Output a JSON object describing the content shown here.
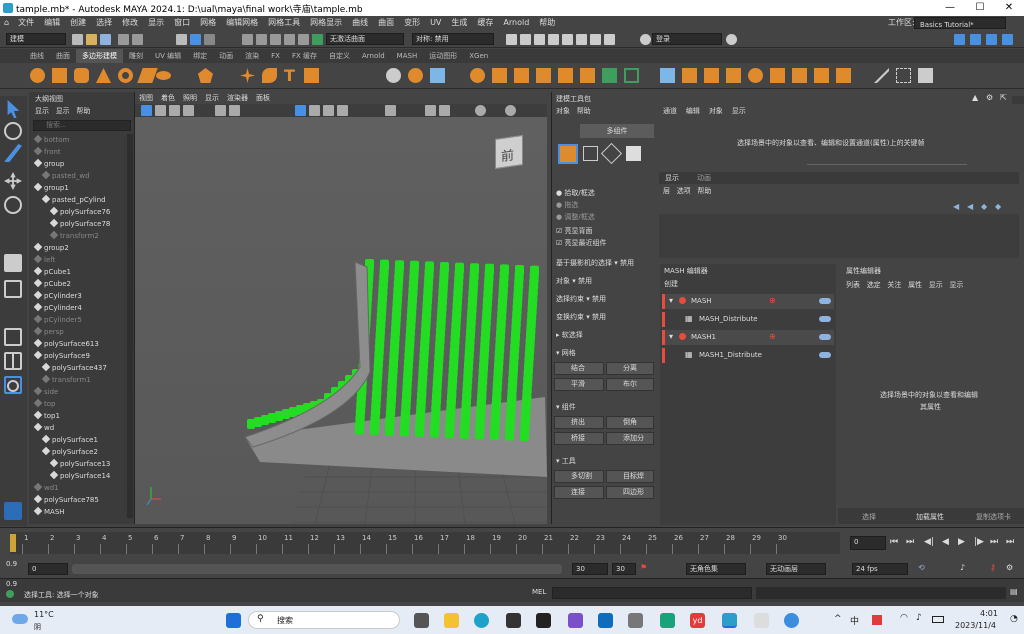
{
  "title": "tample.mb* - Autodesk MAYA 2024.1: D:\\ual\\maya\\final work\\寺庙\\tample.mb",
  "menus": [
    "文件",
    "编辑",
    "创建",
    "选择",
    "修改",
    "显示",
    "窗口",
    "网格",
    "编辑网格",
    "网格工具",
    "网格显示",
    "曲线",
    "曲面",
    "变形",
    "UV",
    "生成",
    "缓存",
    "Arnold",
    "帮助"
  ],
  "workspace_label": "工作区:",
  "workspace": "Basics Tutorial*",
  "mode": "建模",
  "no_live": "无激活曲面",
  "symmetry": "对称: 禁用",
  "login": "登录",
  "shelf_tabs": [
    "曲线",
    "曲面",
    "多边形建模",
    "雕刻",
    "UV 编辑",
    "绑定",
    "动画",
    "渲染",
    "FX",
    "FX 缓存",
    "自定义",
    "Arnold",
    "MASH",
    "运动图形",
    "XGen"
  ],
  "outliner": {
    "title": "大纲视图",
    "menu": [
      "显示",
      "显示",
      "帮助"
    ],
    "search": "搜索...",
    "items": [
      {
        "t": "bottom",
        "d": 0,
        "dim": true
      },
      {
        "t": "front",
        "d": 0,
        "dim": true
      },
      {
        "t": "group",
        "d": 0
      },
      {
        "t": "pasted_wd",
        "d": 1,
        "dim": true
      },
      {
        "t": "group1",
        "d": 0
      },
      {
        "t": "pasted_pCylind",
        "d": 1
      },
      {
        "t": "polySurface76",
        "d": 2
      },
      {
        "t": "polySurface78",
        "d": 2
      },
      {
        "t": "transform2",
        "d": 2,
        "dim": true
      },
      {
        "t": "group2",
        "d": 0
      },
      {
        "t": "left",
        "d": 0,
        "dim": true
      },
      {
        "t": "pCube1",
        "d": 0
      },
      {
        "t": "pCube2",
        "d": 0
      },
      {
        "t": "pCylinder3",
        "d": 0
      },
      {
        "t": "pCylinder4",
        "d": 0
      },
      {
        "t": "pCylinder5",
        "d": 0,
        "dim": true
      },
      {
        "t": "persp",
        "d": 0,
        "dim": true
      },
      {
        "t": "polySurface613",
        "d": 0
      },
      {
        "t": "polySurface9",
        "d": 0
      },
      {
        "t": "polySurface437",
        "d": 1
      },
      {
        "t": "transform1",
        "d": 1,
        "dim": true
      },
      {
        "t": "side",
        "d": 0,
        "dim": true
      },
      {
        "t": "top",
        "d": 0,
        "dim": true
      },
      {
        "t": "top1",
        "d": 0
      },
      {
        "t": "wd",
        "d": 0
      },
      {
        "t": "polySurface1",
        "d": 1
      },
      {
        "t": "polySurface2",
        "d": 1
      },
      {
        "t": "polySurface13",
        "d": 2
      },
      {
        "t": "polySurface14",
        "d": 2
      },
      {
        "t": "wd1",
        "d": 0,
        "dim": true
      },
      {
        "t": "polySurface785",
        "d": 0
      },
      {
        "t": "MASH",
        "d": 0
      }
    ]
  },
  "viewport": {
    "menu": [
      "视图",
      "着色",
      "照明",
      "显示",
      "渲染器",
      "面板"
    ],
    "viewcube": "前"
  },
  "mtk": {
    "title": "建模工具包",
    "menu": [
      "对象",
      "帮助"
    ],
    "mode": "多组件",
    "pick": "拾取/框选",
    "drag": "拖选",
    "tweak": "调整/框选",
    "backface": "亮显背面",
    "nearest": "亮显最近组件",
    "camera_sel": "基于摄影机的选择",
    "off": "禁用",
    "obj": "对象",
    "sel_constraint": "选择约束",
    "xform_constraint": "变换约束",
    "soft": "软选择",
    "mesh": "网格",
    "combine": "结合",
    "separate": "分离",
    "smooth": "平滑",
    "boolean": "布尔",
    "components": "组件",
    "extrude": "挤出",
    "bevel": "倒角",
    "bridge": "桥接",
    "add_div": "添加分",
    "tools": "工具",
    "multicut": "多切割",
    "target_weld": "目标焊",
    "connect": "连接",
    "quad_draw": "四边形"
  },
  "channel": {
    "menu": [
      "通道",
      "编辑",
      "对象",
      "显示"
    ],
    "msg": "选择场景中的对象以查看、编辑和设置通道(属性)上的关键帧",
    "layer_tabs": [
      "显示",
      "动画"
    ],
    "layer_menu": [
      "层",
      "选项",
      "帮助"
    ]
  },
  "mash": {
    "title": "MASH 编辑器",
    "create": "创建",
    "nodes": [
      {
        "name": "MASH",
        "child": "MASH_Distribute"
      },
      {
        "name": "MASH1",
        "child": "MASH1_Distribute"
      }
    ]
  },
  "attr": {
    "title": "属性编辑器",
    "menu": [
      "列表",
      "选定",
      "关注",
      "属性",
      "显示",
      "显示"
    ],
    "msg1": "选择场景中的对象以查看和编辑",
    "msg2": "其属性",
    "footer": [
      "选择",
      "加载属性",
      "复制选项卡"
    ]
  },
  "timeline": {
    "ticks": [
      "1",
      "2",
      "3",
      "4",
      "5",
      "6",
      "7",
      "8",
      "9",
      "10",
      "11",
      "12",
      "13",
      "14",
      "15",
      "16",
      "17",
      "18",
      "19",
      "20",
      "21",
      "22",
      "23",
      "24",
      "25",
      "26",
      "27",
      "28",
      "29",
      "30"
    ],
    "current": "0"
  },
  "range": {
    "start": "0.9",
    "start2": "0",
    "end": "30",
    "end2": "30",
    "char": "无角色集",
    "anim": "无动画层",
    "fps": "24 fps",
    "frame_a": "0.9",
    "frame_b": "0.9"
  },
  "cmd": {
    "lang": "MEL",
    "status": "选择工具: 选择一个对象"
  },
  "taskbar": {
    "temp": "11°C",
    "weather": "阴",
    "search": "搜索",
    "time": "4:01",
    "date": "2023/11/4",
    "ime": "中",
    "badge": "yd"
  },
  "colors": {
    "accent": "#4a90e2",
    "green": "#22dd22",
    "orange": "#e08a2e"
  }
}
